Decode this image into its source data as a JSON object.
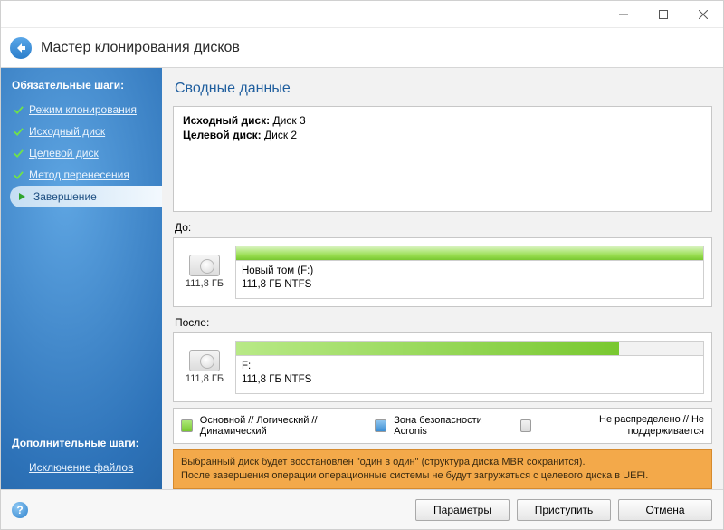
{
  "window": {
    "title": "Мастер клонирования дисков"
  },
  "sidebar": {
    "required_heading": "Обязательные шаги:",
    "optional_heading": "Дополнительные шаги:",
    "steps": [
      {
        "label": "Режим клонирования"
      },
      {
        "label": "Исходный диск"
      },
      {
        "label": "Целевой диск"
      },
      {
        "label": "Метод перенесения"
      },
      {
        "label": "Завершение"
      }
    ],
    "optional_steps": [
      {
        "label": "Исключение файлов"
      }
    ]
  },
  "summary": {
    "title": "Сводные данные",
    "source_label": "Исходный диск:",
    "source_value": "Диск 3",
    "target_label": "Целевой диск:",
    "target_value": "Диск 2",
    "before_label": "До:",
    "after_label": "После:",
    "before_disk": {
      "size": "111,8 ГБ",
      "vol_name": "Новый том (F:)",
      "vol_detail": "111,8 ГБ  NTFS"
    },
    "after_disk": {
      "size": "111,8 ГБ",
      "vol_name": "F:",
      "vol_detail": "111,8 ГБ  NTFS"
    }
  },
  "legend": {
    "primary": "Основной // Логический // Динамический",
    "zone": "Зона безопасности Acronis",
    "unalloc": "Не распределено // Не поддерживается"
  },
  "warning": {
    "line1": "Выбранный диск будет восстановлен \"один в один\" (структура диска MBR сохранится).",
    "line2": "После завершения операции операционные системы не будут загружаться с целевого диска в UEFI."
  },
  "footer": {
    "params": "Параметры",
    "proceed": "Приступить",
    "cancel": "Отмена"
  }
}
